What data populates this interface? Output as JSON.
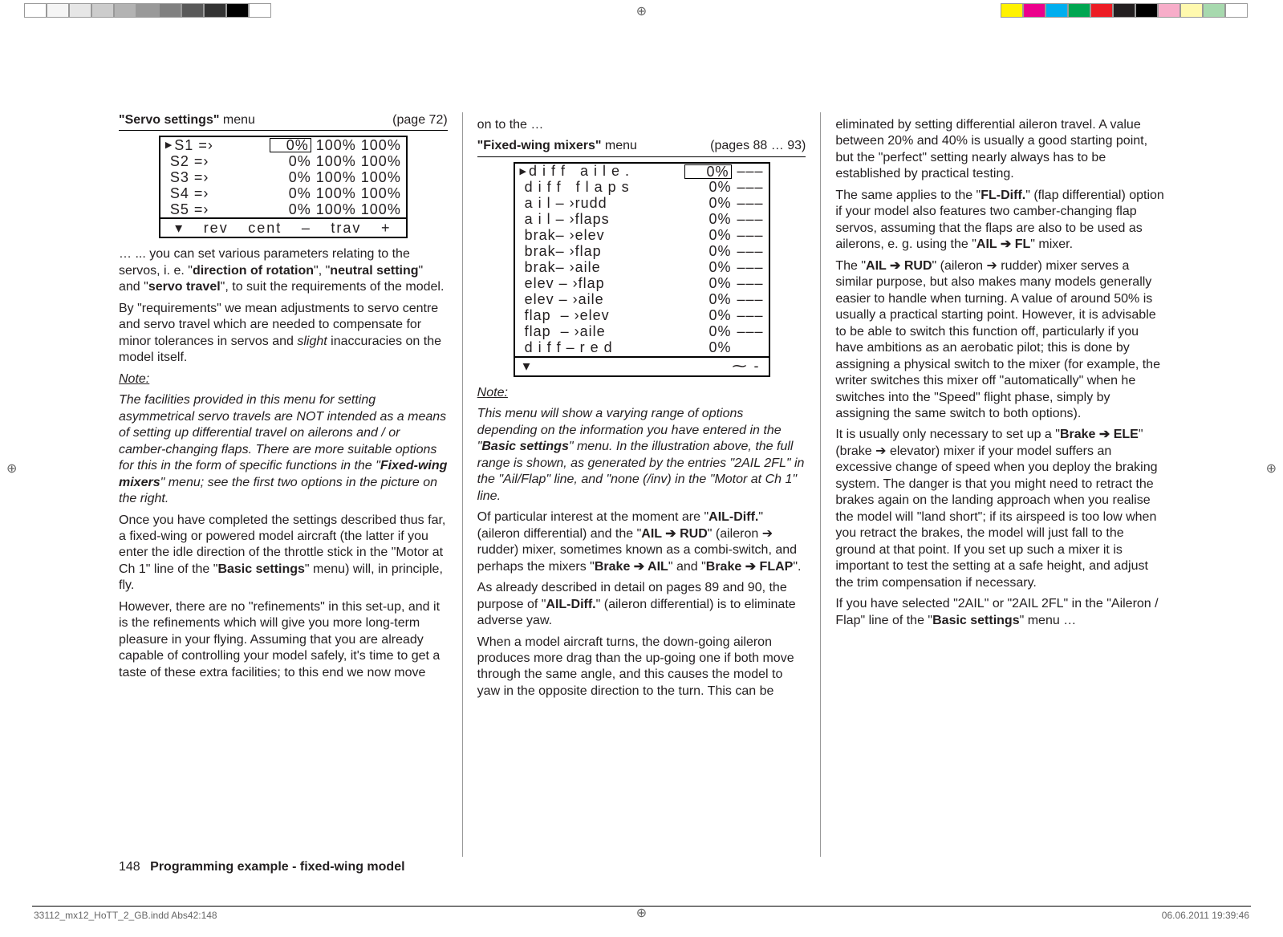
{
  "colorbars": {
    "left": [
      "#ffffff",
      "#f5f5f5",
      "#e6e6e6",
      "#cccccc",
      "#b3b3b3",
      "#999999",
      "#808080",
      "#595959",
      "#333333",
      "#000000",
      "#ffffff"
    ],
    "right": [
      "#fff200",
      "#ec008c",
      "#00aeef",
      "#00a651",
      "#ed1c24",
      "#231f20",
      "#000000",
      "#f7adc9",
      "#fff9ae",
      "#a7d9ae",
      "#ffffff"
    ]
  },
  "col1": {
    "menu_name": "\"Servo settings\"",
    "menu_word": " menu",
    "page_ref": "(page 72)",
    "servo_rows": [
      {
        "tri": "▶",
        "id": "S1",
        "arr": "=›",
        "c1": "0%",
        "c1sel": true,
        "c2": "100%",
        "c3": "100%"
      },
      {
        "tri": "",
        "id": "S2",
        "arr": "=›",
        "c1": "0%",
        "c1sel": false,
        "c2": "100%",
        "c3": "100%"
      },
      {
        "tri": "",
        "id": "S3",
        "arr": "=›",
        "c1": "0%",
        "c1sel": false,
        "c2": "100%",
        "c3": "100%"
      },
      {
        "tri": "",
        "id": "S4",
        "arr": "=›",
        "c1": "0%",
        "c1sel": false,
        "c2": "100%",
        "c3": "100%"
      },
      {
        "tri": "",
        "id": "S5",
        "arr": "=›",
        "c1": "0%",
        "c1sel": false,
        "c2": "100%",
        "c3": "100%"
      }
    ],
    "servo_footer": [
      "▾",
      "rev",
      "cent",
      "–",
      "trav",
      "+"
    ],
    "p1a": "… ... you can set various parameters relating to the servos, i. e. \"",
    "p1b": "direction of rotation",
    "p1c": "\", \"",
    "p1d": "neutral setting",
    "p1e": "\" and \"",
    "p1f": "servo travel",
    "p1g": "\", to suit the requirements of the model.",
    "p2a": "By \"requirements\" we mean adjustments to servo centre and servo travel which are needed to compensate for minor tolerances in servos and ",
    "p2b": "slight",
    "p2c": " inaccuracies on the model itself.",
    "note": "Note:",
    "p3a": "The facilities provided in this menu for setting asymmetrical servo travels are NOT intended as a means of setting up differential travel on ailerons and / or camber-changing flaps. There are more suitable options for this in the form of specific functions in the \"",
    "p3b": "Fixed-wing mixers",
    "p3c": "\" menu; see the first two options in the picture on the right.",
    "p4a": "Once you have completed the settings described thus far, a fixed-wing or powered model aircraft (the latter if you enter the idle direction of the throttle stick in the \"Motor at Ch 1\" line of the \"",
    "p4b": "Basic settings",
    "p4c": "\" menu) will, in principle, fly.",
    "p5": "However, there are no \"refinements\" in this set-up, and it is the refinements which will give you more long-term pleasure in your flying. Assuming that you are already capable of controlling your model safely, it's time to get a taste of these extra facilities; to this end we now move"
  },
  "col2": {
    "cont": "on to the …",
    "menu_name": "\"Fixed-wing mixers\"",
    "menu_word": " menu",
    "page_ref": "(pages 88 … 93)",
    "mixer_rows": [
      {
        "tri": "▶",
        "label": "d i f f   a i l e .",
        "val": "0%",
        "sel": true,
        "dash": "–––"
      },
      {
        "tri": "",
        "label": "d i f f   f l a p s",
        "val": "0%",
        "sel": false,
        "dash": "–––"
      },
      {
        "tri": "",
        "label": "a i l – ›rudd",
        "val": "0%",
        "sel": false,
        "dash": "–––"
      },
      {
        "tri": "",
        "label": "a i l – ›flaps",
        "val": "0%",
        "sel": false,
        "dash": "–––"
      },
      {
        "tri": "",
        "label": "brak– ›elev",
        "val": "0%",
        "sel": false,
        "dash": "–––"
      },
      {
        "tri": "",
        "label": "brak– ›flap",
        "val": "0%",
        "sel": false,
        "dash": "–––"
      },
      {
        "tri": "",
        "label": "brak– ›aile",
        "val": "0%",
        "sel": false,
        "dash": "–––"
      },
      {
        "tri": "",
        "label": "elev – ›flap",
        "val": "0%",
        "sel": false,
        "dash": "–––"
      },
      {
        "tri": "",
        "label": "elev – ›aile",
        "val": "0%",
        "sel": false,
        "dash": "–––"
      },
      {
        "tri": "",
        "label": "flap  – ›elev",
        "val": "0%",
        "sel": false,
        "dash": "–––"
      },
      {
        "tri": "",
        "label": "flap  – ›aile",
        "val": "0%",
        "sel": false,
        "dash": "–––"
      },
      {
        "tri": "",
        "label": "d i f f – r e d",
        "val": "0%",
        "sel": false,
        "dash": ""
      }
    ],
    "mixer_footer_left": "▾",
    "mixer_footer_right": "⁓ -",
    "note": "Note:",
    "p1a": "This menu will show a varying range of options depending on the information you have entered in the \"",
    "p1b": "Basic settings",
    "p1c": "\" menu. In the illustration above, the full range is shown, as generated by the entries \"2AIL  2FL\" in the \"Ail/Flap\" line, and \"none (/inv) in the \"Motor at Ch 1\" line.",
    "p2a": "Of particular interest at the moment are \"",
    "p2b": "AIL-Diff.",
    "p2c": "\" (aileron differential) and the \"",
    "p2d": "AIL ",
    "p2e": "➔",
    "p2f": " RUD",
    "p2g": "\" (aileron ",
    "p2h": "➔",
    "p2i": " rudder) mixer, sometimes known as a combi-switch, and perhaps the mixers \"",
    "p2j": "Brake ",
    "p2k": "➔",
    "p2l": " AIL",
    "p2m": "\" and \"",
    "p2n": "Brake ",
    "p2o": "➔",
    "p2p": " FLAP",
    "p2q": "\".",
    "p3a": "As already described in detail on pages 89 and 90, the purpose of \"",
    "p3b": "AIL-Diff.",
    "p3c": "\" (aileron differential) is to eliminate adverse yaw.",
    "p4": "When a model aircraft turns, the down-going aileron produces more drag than the up-going one if both move through the same angle, and this causes the model to yaw in the opposite direction to the turn. This can be"
  },
  "col3": {
    "p1": "eliminated by setting differential aileron travel. A value between 20% and 40% is usually a good starting point, but the \"perfect\" setting nearly always has to be established by practical testing.",
    "p2a": "The same applies to the \"",
    "p2b": "FL-Diff.",
    "p2c": "\" (flap differential) option if your model also features two camber-changing flap servos, assuming that the flaps are also to be used as ailerons, e. g. using the \"",
    "p2d": "AIL ",
    "p2e": "➔",
    "p2f": " FL",
    "p2g": "\" mixer.",
    "p3a": "The \"",
    "p3b": "AIL ",
    "p3c": "➔",
    "p3d": " RUD",
    "p3e": "\" (aileron ",
    "p3f": "➔",
    "p3g": " rudder) mixer serves a similar purpose, but also makes many models generally easier to handle when turning. A value of around 50% is usually a practical starting point. However, it is advisable to be able to switch this function off, particularly if you have ambitions as an aerobatic pilot; this is done by assigning a physical switch to the mixer (for example, the writer switches this mixer off \"automatically\" when he switches into the \"Speed\" flight phase, simply by assigning the same switch to both options).",
    "p4a": "It is usually only necessary to set up a \"",
    "p4b": "Brake ",
    "p4c": "➔",
    "p4d": " ELE",
    "p4e": "\" (brake ",
    "p4f": "➔",
    "p4g": " elevator) mixer if your model suffers an excessive change of speed when you deploy the braking system. The danger is that you might need to retract the brakes again on the landing approach when you realise the model will \"land short\"; if its airspeed is too low when you retract the brakes, the model will just fall to the ground at that point. If you set up such a mixer it is important to test the setting at a safe height, and adjust the trim compensation if necessary.",
    "p5a": "If you have selected \"2AIL\" or \"2AIL 2FL\" in the \"Aileron / Flap\" line of the \"",
    "p5b": "Basic settings",
    "p5c": "\" menu …"
  },
  "footer": {
    "pn": "148",
    "title": "Programming example - fixed-wing model"
  },
  "meta": {
    "file": "33112_mx12_HoTT_2_GB.indd   Abs42:148",
    "date": "06.06.2011   19:39:46"
  }
}
